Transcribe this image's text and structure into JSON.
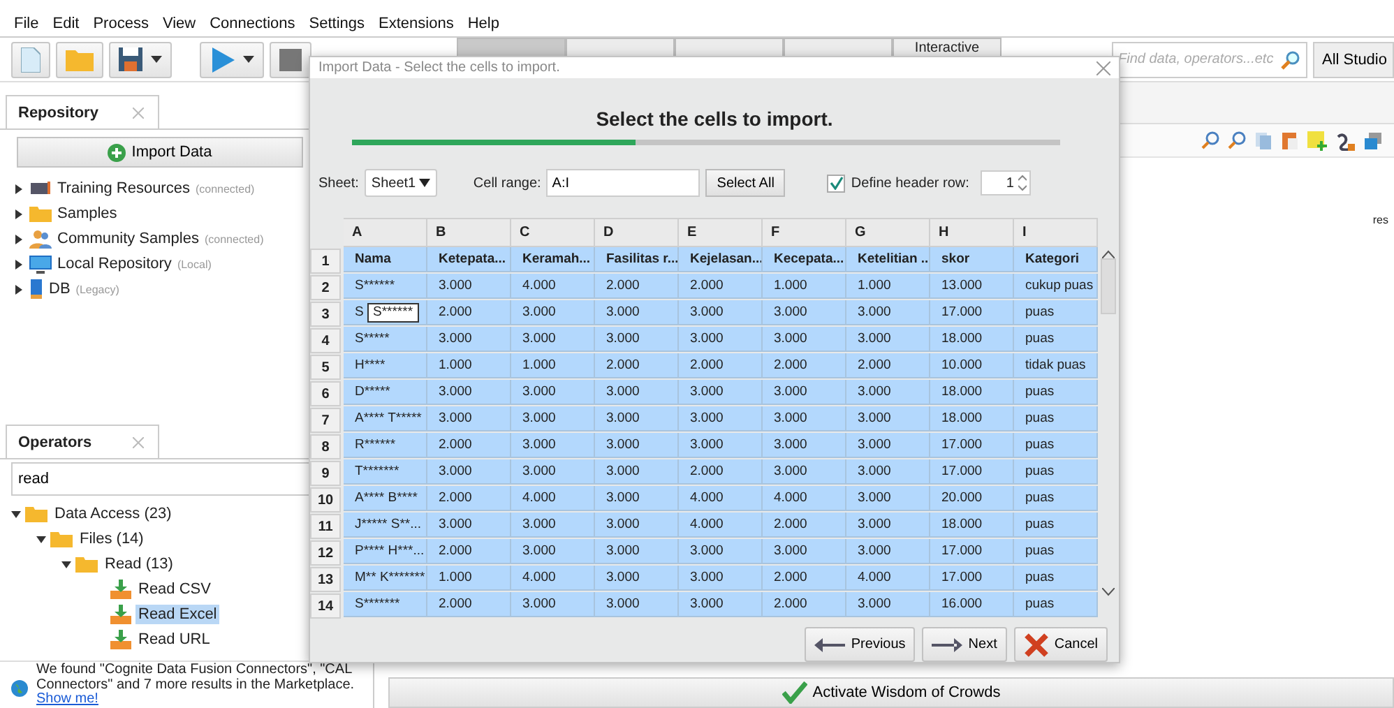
{
  "menu": [
    "File",
    "Edit",
    "Process",
    "View",
    "Connections",
    "Settings",
    "Extensions",
    "Help"
  ],
  "tabs": [
    {
      "selected": true
    },
    {
      "selected": false
    },
    {
      "selected": false
    },
    {
      "selected": false
    },
    {
      "label": "Interactive",
      "selected": false
    }
  ],
  "global_search": {
    "placeholder": "Find data, operators...etc",
    "scope_button": "All Studio"
  },
  "repository": {
    "title": "Repository",
    "import_button": "Import Data",
    "items": [
      {
        "kind": "training",
        "label": "Training Resources",
        "note": "(connected)",
        "expanded": false
      },
      {
        "kind": "folder",
        "label": "Samples",
        "expanded": false
      },
      {
        "kind": "people",
        "label": "Community Samples",
        "note": "(connected)",
        "expanded": false
      },
      {
        "kind": "monitor",
        "label": "Local Repository",
        "note": "(Local)",
        "expanded": false
      },
      {
        "kind": "database",
        "label": "DB",
        "note": "(Legacy)",
        "expanded": false
      }
    ]
  },
  "operators": {
    "title": "Operators",
    "search_value": "read",
    "tree": [
      {
        "kind": "folder",
        "label": "Data Access (23)",
        "expanded": true,
        "selected": false,
        "children": [
          {
            "kind": "folder",
            "label": "Files (14)",
            "expanded": true,
            "selected": false,
            "children": [
              {
                "kind": "folder",
                "label": "Read (13)",
                "expanded": true,
                "selected": false,
                "children": [
                  {
                    "kind": "operator",
                    "label": "Read CSV",
                    "selected": false
                  },
                  {
                    "kind": "operator",
                    "label": "Read Excel",
                    "selected": true
                  },
                  {
                    "kind": "operator",
                    "label": "Read URL",
                    "selected": false
                  }
                ]
              }
            ]
          }
        ]
      }
    ]
  },
  "notice": {
    "text": "We found \"Cognite Data Fusion Connectors\", \"CAL Connectors\" and 7 more results in the Marketplace.",
    "link": "Show me!"
  },
  "canvas": {
    "side_text": "res",
    "activate_button": "Activate Wisdom of Crowds"
  },
  "dialog": {
    "title": "Import Data - Select the cells to import.",
    "heading": "Select the cells to import.",
    "progress": {
      "level": 0.4
    },
    "sheet_label": "Sheet:",
    "sheet_value": "Sheet1",
    "range_label": "Cell range:",
    "range_value": "A:I",
    "select_all": "Select All",
    "header_row": {
      "label": "Define header row:",
      "checked": true,
      "value": "1"
    },
    "columns": [
      "A",
      "B",
      "C",
      "D",
      "E",
      "F",
      "G",
      "H",
      "I"
    ],
    "rows": [
      {
        "num": "1",
        "selected": true,
        "cells": [
          "Nama",
          "Ketepata...",
          "Keramah...",
          "Fasilitas r...",
          "Kejelasan...",
          "Kecepata...",
          "Ketelitian ...",
          "skor",
          "Kategori"
        ]
      },
      {
        "num": "2",
        "selected": true,
        "cells": [
          "S******",
          "3.000",
          "4.000",
          "2.000",
          "2.000",
          "1.000",
          "1.000",
          "13.000",
          "cukup puas"
        ]
      },
      {
        "num": "3",
        "selected": true,
        "cells": [
          "S",
          "2.000",
          "3.000",
          "3.000",
          "3.000",
          "3.000",
          "3.000",
          "17.000",
          "puas"
        ]
      },
      {
        "num": "4",
        "selected": true,
        "cells": [
          "S*****",
          "3.000",
          "3.000",
          "3.000",
          "3.000",
          "3.000",
          "3.000",
          "18.000",
          "puas"
        ]
      },
      {
        "num": "5",
        "selected": true,
        "cells": [
          "H****",
          "1.000",
          "1.000",
          "2.000",
          "2.000",
          "2.000",
          "2.000",
          "10.000",
          "tidak puas"
        ]
      },
      {
        "num": "6",
        "selected": true,
        "cells": [
          "D*****",
          "3.000",
          "3.000",
          "3.000",
          "3.000",
          "3.000",
          "3.000",
          "18.000",
          "puas"
        ]
      },
      {
        "num": "7",
        "selected": true,
        "cells": [
          "A**** T*****",
          "3.000",
          "3.000",
          "3.000",
          "3.000",
          "3.000",
          "3.000",
          "18.000",
          "puas"
        ]
      },
      {
        "num": "8",
        "selected": true,
        "cells": [
          "R******",
          "2.000",
          "3.000",
          "3.000",
          "3.000",
          "3.000",
          "3.000",
          "17.000",
          "puas"
        ]
      },
      {
        "num": "9",
        "selected": true,
        "cells": [
          "T*******",
          "3.000",
          "3.000",
          "3.000",
          "2.000",
          "3.000",
          "3.000",
          "17.000",
          "puas"
        ]
      },
      {
        "num": "10",
        "selected": true,
        "cells": [
          "A**** B****",
          "2.000",
          "4.000",
          "3.000",
          "4.000",
          "4.000",
          "3.000",
          "20.000",
          "puas"
        ]
      },
      {
        "num": "11",
        "selected": true,
        "cells": [
          "J***** S**...",
          "3.000",
          "3.000",
          "3.000",
          "4.000",
          "2.000",
          "3.000",
          "18.000",
          "puas"
        ]
      },
      {
        "num": "12",
        "selected": true,
        "cells": [
          "P**** H***...",
          "2.000",
          "3.000",
          "3.000",
          "3.000",
          "3.000",
          "3.000",
          "17.000",
          "puas"
        ]
      },
      {
        "num": "13",
        "selected": true,
        "cells": [
          "M** K*******",
          "1.000",
          "4.000",
          "3.000",
          "3.000",
          "2.000",
          "4.000",
          "17.000",
          "puas"
        ]
      },
      {
        "num": "14",
        "selected": true,
        "cells": [
          "S*******",
          "2.000",
          "3.000",
          "3.000",
          "3.000",
          "2.000",
          "3.000",
          "16.000",
          "puas"
        ]
      }
    ],
    "tooltip": "S******",
    "buttons": [
      {
        "kind": "previous",
        "label": "Previous"
      },
      {
        "kind": "next",
        "label": "Next"
      },
      {
        "kind": "cancel",
        "label": "Cancel"
      }
    ]
  }
}
